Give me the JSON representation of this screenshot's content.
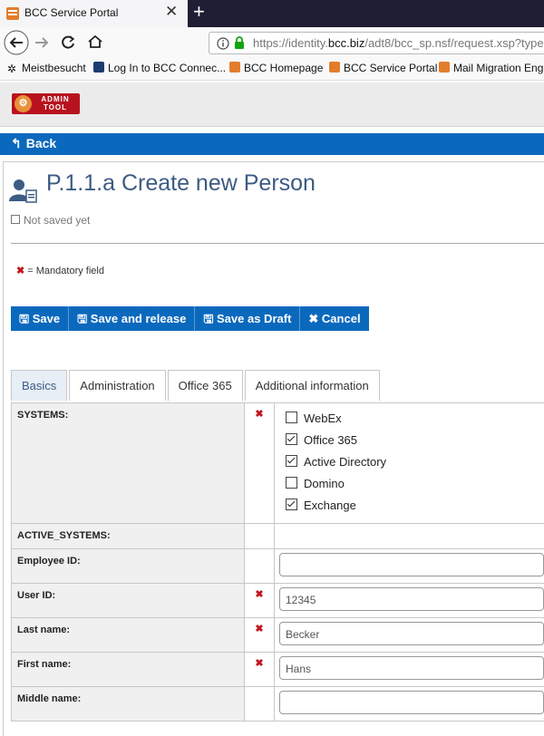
{
  "browser": {
    "tab_title": "BCC Service Portal",
    "url_prefix": "https://identity.",
    "url_domain": "bcc.biz",
    "url_rest": "/adt8/bcc_sp.nsf/request.xsp?type",
    "bookmarks": [
      "Meistbesucht",
      "Log In to BCC Connec...",
      "BCC Homepage",
      "BCC Service Portal",
      "Mail Migration Engi"
    ]
  },
  "logo": {
    "line1": "ADMIN",
    "line2": "TOOL"
  },
  "back_label": "Back",
  "page": {
    "title": "P.1.1.a Create new Person",
    "status": "Not saved yet",
    "mandatory_note": "= Mandatory field"
  },
  "toolbar": {
    "save": "Save",
    "save_release": "Save and release",
    "save_draft": "Save as Draft",
    "cancel": "Cancel"
  },
  "tabs": [
    "Basics",
    "Administration",
    "Office 365",
    "Additional information"
  ],
  "form": {
    "systems_label": "SYSTEMS:",
    "systems": [
      {
        "label": "WebEx",
        "checked": false
      },
      {
        "label": "Office 365",
        "checked": true
      },
      {
        "label": "Active Directory",
        "checked": true
      },
      {
        "label": "Domino",
        "checked": false
      },
      {
        "label": "Exchange",
        "checked": true
      }
    ],
    "active_systems_label": "ACTIVE_SYSTEMS:",
    "employee_id_label": "Employee ID:",
    "employee_id_value": "",
    "user_id_label": "User ID:",
    "user_id_value": "12345",
    "last_name_label": "Last name:",
    "last_name_value": "Becker",
    "first_name_label": "First name:",
    "first_name_value": "Hans",
    "middle_name_label": "Middle name:",
    "middle_name_value": ""
  },
  "colors": {
    "accent": "#0b69bd",
    "title": "#3d5b83",
    "mandatory": "#c0161e",
    "logo": "#b8121e"
  }
}
